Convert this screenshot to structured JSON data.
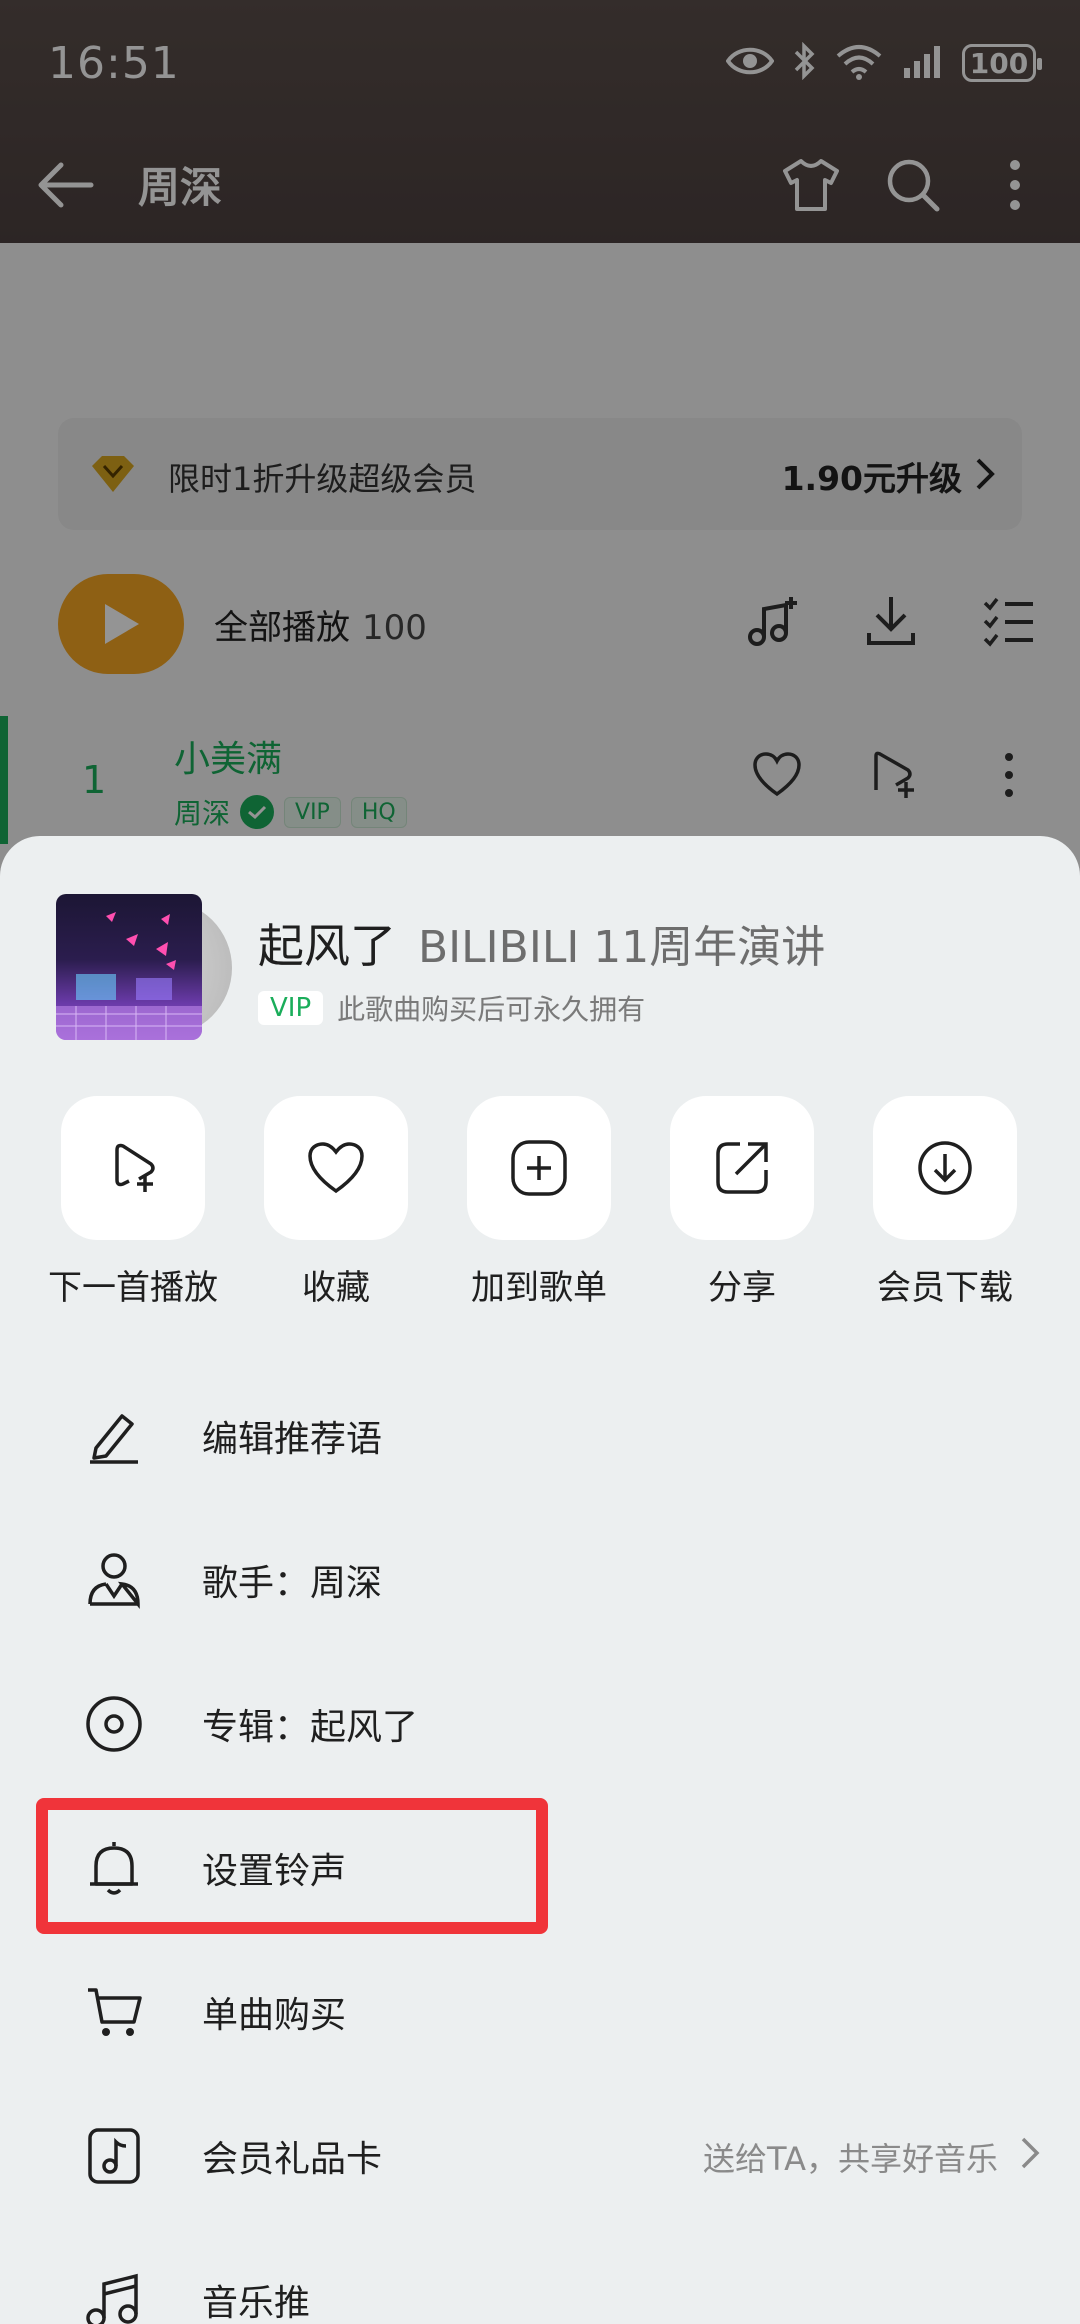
{
  "status_bar": {
    "time": "16:51",
    "battery": "100"
  },
  "nav": {
    "title": "周深"
  },
  "vip_banner": {
    "text": "限时1折升级超级会员",
    "price": "1.90元升级"
  },
  "play_all": {
    "label": "全部播放",
    "count": "100"
  },
  "current_song": {
    "number": "1",
    "title": "小美满",
    "artist": "周深",
    "tags": [
      "VIP",
      "HQ"
    ]
  },
  "sheet": {
    "song_title": "起风了",
    "song_subtitle": "BILIBILI 11周年演讲",
    "vip_badge": "VIP",
    "vip_note": "此歌曲购买后可永久拥有",
    "actions": [
      {
        "label": "下一首播放",
        "icon": "play-next-icon"
      },
      {
        "label": "收藏",
        "icon": "heart-icon"
      },
      {
        "label": "加到歌单",
        "icon": "add-icon"
      },
      {
        "label": "分享",
        "icon": "share-icon"
      },
      {
        "label": "会员下载",
        "icon": "download-icon"
      }
    ],
    "menu": [
      {
        "label": "编辑推荐语",
        "icon": "pencil-icon"
      },
      {
        "label": "歌手：周深",
        "icon": "singer-icon"
      },
      {
        "label": "专辑：起风了",
        "icon": "album-disc-icon"
      },
      {
        "label": "设置铃声",
        "icon": "bell-icon"
      },
      {
        "label": "单曲购买",
        "icon": "cart-icon"
      },
      {
        "label": "会员礼品卡",
        "icon": "gift-card-icon",
        "extra": "送给TA，共享好音乐"
      },
      {
        "label": "音乐推",
        "icon": "music-notes-icon"
      }
    ]
  },
  "colors": {
    "accent_green": "#1aad5a",
    "play_orange": "#f5a623",
    "highlight_red": "#f0343a"
  }
}
